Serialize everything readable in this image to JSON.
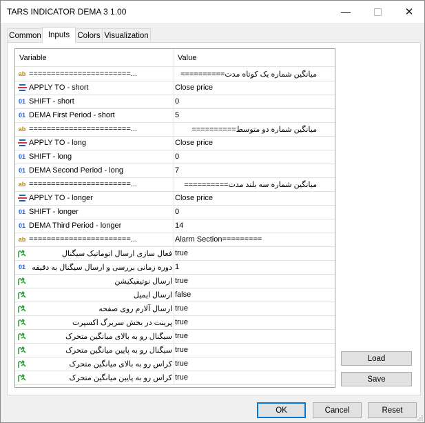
{
  "window": {
    "title": "TARS INDICATOR DEMA 3 1.00"
  },
  "tabs": [
    "Common",
    "Inputs",
    "Colors",
    "Visualization"
  ],
  "active_tab": "Inputs",
  "grid": {
    "headers": {
      "variable": "Variable",
      "value": "Value"
    },
    "rows": [
      {
        "icon": "ab",
        "variable": "=======================...",
        "value": "میانگین شماره یک کوتاه مدت==========",
        "value_rtl": true
      },
      {
        "icon": "enum",
        "variable": "APPLY TO - short",
        "value": "Close price"
      },
      {
        "icon": "01",
        "variable": "SHIFT - short",
        "value": "0"
      },
      {
        "icon": "01",
        "variable": "DEMA First Period - short",
        "value": "5"
      },
      {
        "icon": "ab",
        "variable": "=======================...",
        "value": "میانگین شماره دو متوسط==========",
        "value_rtl": true
      },
      {
        "icon": "enum",
        "variable": "APPLY TO - long",
        "value": "Close price"
      },
      {
        "icon": "01",
        "variable": "SHIFT  - long",
        "value": "0"
      },
      {
        "icon": "01",
        "variable": "DEMA Second Period - long",
        "value": "7"
      },
      {
        "icon": "ab",
        "variable": "=======================...",
        "value": "میانگین شماره سه بلند مدت==========",
        "value_rtl": true
      },
      {
        "icon": "enum",
        "variable": "APPLY TO  - longer",
        "value": "Close price"
      },
      {
        "icon": "01",
        "variable": "SHIFT  - longer",
        "value": "0"
      },
      {
        "icon": "01",
        "variable": "DEMA Third Period - longer",
        "value": "14"
      },
      {
        "icon": "ab",
        "variable": "=======================...",
        "value": "Alarm Section========="
      },
      {
        "icon": "bool",
        "variable": "فعال سازی ارسال اتوماتیک سیگنال",
        "variable_rtl": true,
        "value": "true"
      },
      {
        "icon": "01",
        "variable": "دوره زمانی بررسی و ارسال سیگنال به دقیقه",
        "variable_rtl": true,
        "value": "1"
      },
      {
        "icon": "bool",
        "variable": "ارسال نوتیفیکیشن",
        "variable_rtl": true,
        "value": "true"
      },
      {
        "icon": "bool",
        "variable": "ارسال ایمیل",
        "variable_rtl": true,
        "value": "false"
      },
      {
        "icon": "bool",
        "variable": "ارسال آلارم روی صفحه",
        "variable_rtl": true,
        "value": "true"
      },
      {
        "icon": "bool",
        "variable": "پرینت در بخش سربرگ اکسپرت",
        "variable_rtl": true,
        "value": "true"
      },
      {
        "icon": "bool",
        "variable": "سیگنال رو به بالای میانگین متحرک",
        "variable_rtl": true,
        "value": "true"
      },
      {
        "icon": "bool",
        "variable": "سیگنال رو به پایین میانگین متحرک",
        "variable_rtl": true,
        "value": "true"
      },
      {
        "icon": "bool",
        "variable": "کراس رو به بالای میانگین متحرک",
        "variable_rtl": true,
        "value": "true"
      },
      {
        "icon": "bool",
        "variable": "کراس رو به پایین میانگین متحرک",
        "variable_rtl": true,
        "value": "true"
      }
    ]
  },
  "buttons": {
    "load": "Load",
    "save": "Save",
    "ok": "OK",
    "cancel": "Cancel",
    "reset": "Reset"
  },
  "icon_labels": {
    "ab": "ab",
    "01": "01"
  },
  "colors": {
    "accent": "#0078d7",
    "string_icon": "#c87f00",
    "int_icon": "#1f5fbf",
    "bool_icon": "#2e9e3a"
  }
}
